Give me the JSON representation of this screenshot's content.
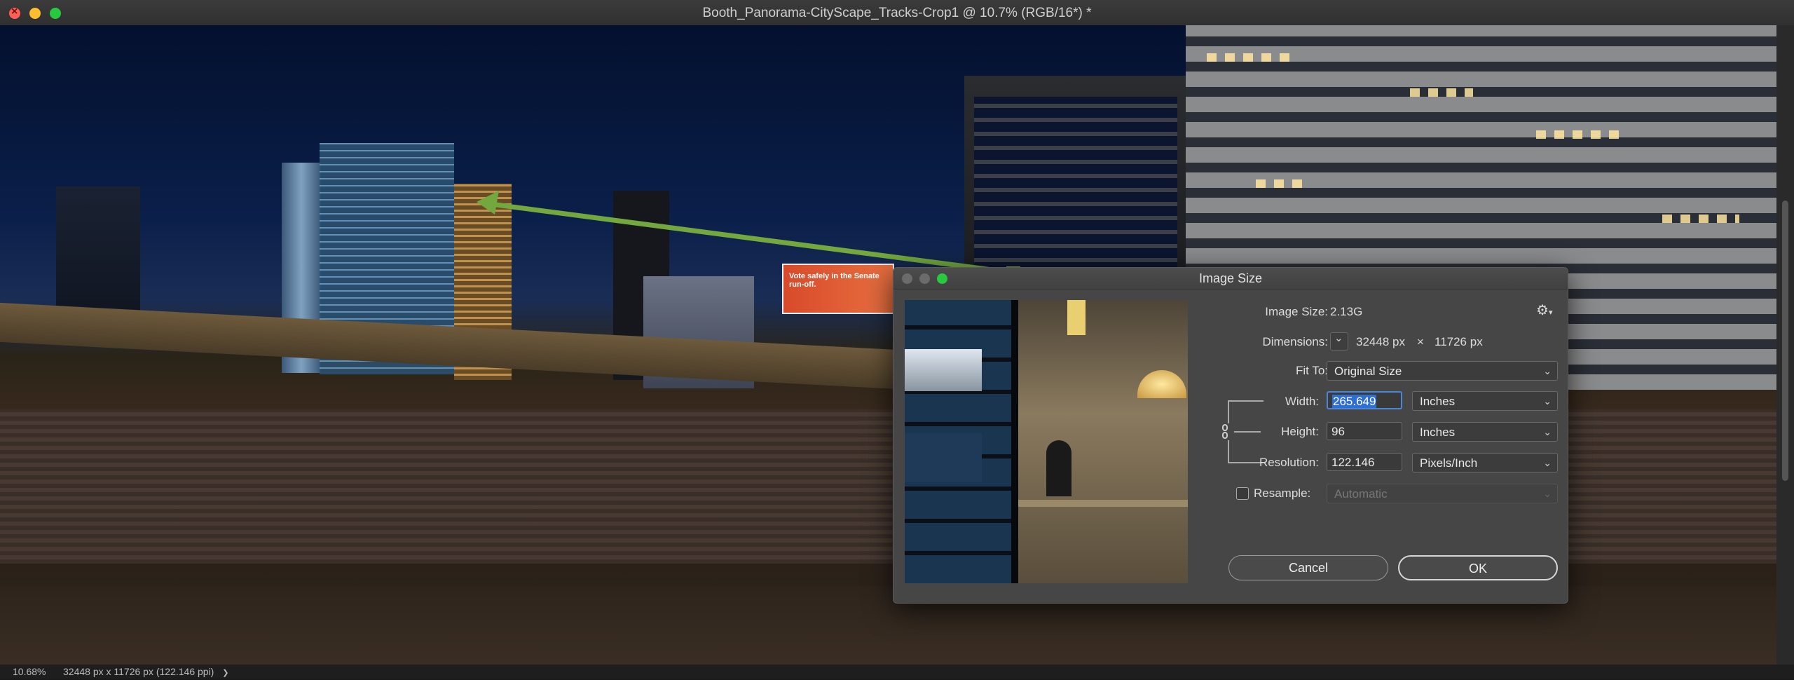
{
  "window": {
    "title": "Booth_Panorama-CityScape_Tracks-Crop1 @ 10.7% (RGB/16*) *"
  },
  "photo": {
    "billboard_text": "Vote safely in the Senate run-off."
  },
  "status_bar": {
    "zoom": "10.68%",
    "document_info": "32448 px x 11726 px (122.146 ppi)",
    "arrow_glyph": "❯"
  },
  "dialog": {
    "title": "Image Size",
    "image_size_label": "Image Size:",
    "image_size_value": "2.13G",
    "dimensions_label": "Dimensions:",
    "dimensions_width": "32448 px",
    "dimensions_times": "×",
    "dimensions_height": "11726 px",
    "fit_to_label": "Fit To:",
    "fit_to_value": "Original Size",
    "width_label": "Width:",
    "width_value": "265.649",
    "width_unit": "Inches",
    "height_label": "Height:",
    "height_value": "96",
    "height_unit": "Inches",
    "resolution_label": "Resolution:",
    "resolution_value": "122.146",
    "resolution_unit": "Pixels/Inch",
    "resample_label": "Resample:",
    "resample_checked": false,
    "resample_value": "Automatic",
    "cancel_label": "Cancel",
    "ok_label": "OK"
  },
  "colors": {
    "accent_arrow": "#72a83e",
    "focus_ring": "#4c86d8",
    "selection": "#2f6fd1"
  }
}
